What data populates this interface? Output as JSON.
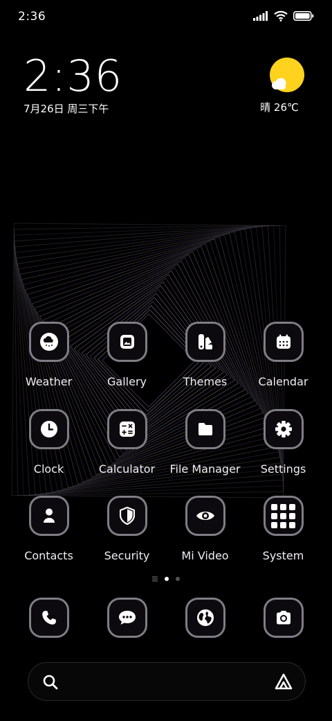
{
  "status_bar": {
    "time": "2:36"
  },
  "clock_widget": {
    "time": "2:36",
    "date": "7月26日 周三下午"
  },
  "weather_widget": {
    "label": "晴 26℃",
    "sun_color": "#FFD21E"
  },
  "apps": [
    {
      "label": "Weather",
      "icon": "cloud-snow-icon"
    },
    {
      "label": "Gallery",
      "icon": "image-icon"
    },
    {
      "label": "Themes",
      "icon": "themes-icon"
    },
    {
      "label": "Calendar",
      "icon": "calendar-icon"
    },
    {
      "label": "Clock",
      "icon": "clock-icon"
    },
    {
      "label": "Calculator",
      "icon": "calculator-icon"
    },
    {
      "label": "File Manager",
      "icon": "folder-icon"
    },
    {
      "label": "Settings",
      "icon": "gear-icon"
    },
    {
      "label": "Contacts",
      "icon": "person-icon"
    },
    {
      "label": "Security",
      "icon": "shield-icon"
    },
    {
      "label": "Mi Video",
      "icon": "eye-icon"
    },
    {
      "label": "System",
      "icon": "app-folder-icon"
    }
  ],
  "dock": [
    {
      "icon": "phone-icon"
    },
    {
      "icon": "message-icon"
    },
    {
      "icon": "browser-globe-icon"
    },
    {
      "icon": "camera-icon"
    }
  ],
  "page_indicator": {
    "pages": 2,
    "active": 1
  },
  "search_bar": {
    "left_icon": "search-icon",
    "right_icon": "assistant-icon"
  },
  "theme": {
    "background": "#000000",
    "icon_border": "#807d85",
    "accent_purple": "#7a5ba0"
  }
}
